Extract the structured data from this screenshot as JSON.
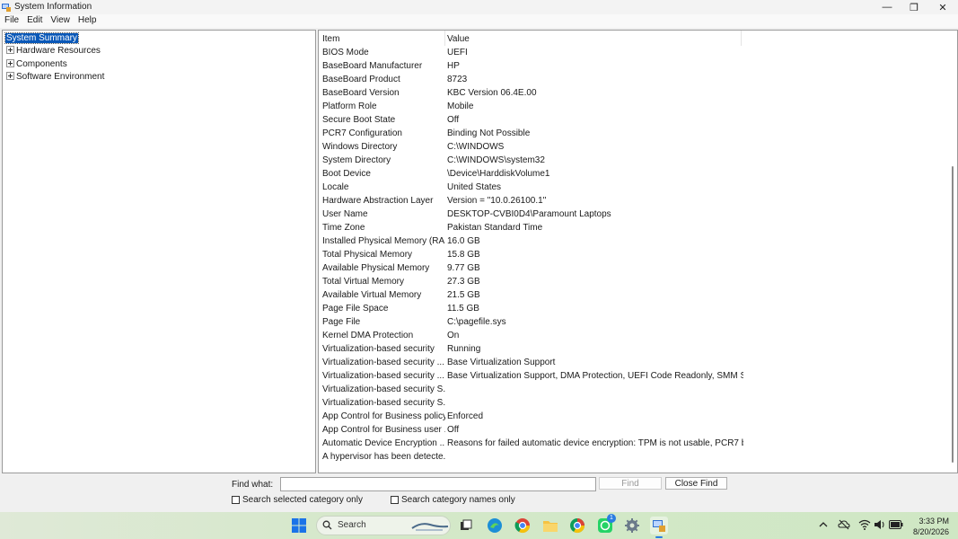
{
  "window": {
    "title": "System Information",
    "minimize": "—",
    "maximize": "❐",
    "close": "✕"
  },
  "menu": [
    "File",
    "Edit",
    "View",
    "Help"
  ],
  "tree": [
    {
      "label": "System Summary",
      "selected": true,
      "expander": false
    },
    {
      "label": "Hardware Resources",
      "selected": false,
      "expander": true
    },
    {
      "label": "Components",
      "selected": false,
      "expander": true
    },
    {
      "label": "Software Environment",
      "selected": false,
      "expander": true
    }
  ],
  "table": {
    "headers": {
      "item": "Item",
      "value": "Value"
    },
    "rows": [
      {
        "item": "BIOS Mode",
        "value": "UEFI"
      },
      {
        "item": "BaseBoard Manufacturer",
        "value": "HP"
      },
      {
        "item": "BaseBoard Product",
        "value": "8723"
      },
      {
        "item": "BaseBoard Version",
        "value": "KBC Version 06.4E.00"
      },
      {
        "item": "Platform Role",
        "value": "Mobile"
      },
      {
        "item": "Secure Boot State",
        "value": "Off"
      },
      {
        "item": "PCR7 Configuration",
        "value": "Binding Not Possible"
      },
      {
        "item": "Windows Directory",
        "value": "C:\\WINDOWS"
      },
      {
        "item": "System Directory",
        "value": "C:\\WINDOWS\\system32"
      },
      {
        "item": "Boot Device",
        "value": "\\Device\\HarddiskVolume1"
      },
      {
        "item": "Locale",
        "value": "United States"
      },
      {
        "item": "Hardware Abstraction Layer",
        "value": "Version = \"10.0.26100.1\""
      },
      {
        "item": "User Name",
        "value": "DESKTOP-CVBI0D4\\Paramount Laptops"
      },
      {
        "item": "Time Zone",
        "value": "Pakistan Standard Time"
      },
      {
        "item": "Installed Physical Memory (RA...",
        "value": "16.0 GB"
      },
      {
        "item": "Total Physical Memory",
        "value": "15.8 GB"
      },
      {
        "item": "Available Physical Memory",
        "value": "9.77 GB"
      },
      {
        "item": "Total Virtual Memory",
        "value": "27.3 GB"
      },
      {
        "item": "Available Virtual Memory",
        "value": "21.5 GB"
      },
      {
        "item": "Page File Space",
        "value": "11.5 GB"
      },
      {
        "item": "Page File",
        "value": "C:\\pagefile.sys"
      },
      {
        "item": "Kernel DMA Protection",
        "value": "On"
      },
      {
        "item": "Virtualization-based security",
        "value": "Running"
      },
      {
        "item": "Virtualization-based security ...",
        "value": "Base Virtualization Support"
      },
      {
        "item": "Virtualization-based security ...",
        "value": "Base Virtualization Support, DMA Protection, UEFI Code Readonly, SMM S..."
      },
      {
        "item": "Virtualization-based security S...",
        "value": ""
      },
      {
        "item": "Virtualization-based security S...",
        "value": ""
      },
      {
        "item": "App Control for Business policy",
        "value": "Enforced"
      },
      {
        "item": "App Control for Business user ...",
        "value": "Off"
      },
      {
        "item": "Automatic Device Encryption ...",
        "value": "Reasons for failed automatic device encryption: TPM is not usable, PCR7 bi..."
      },
      {
        "item": "A hypervisor has been detecte...",
        "value": ""
      }
    ]
  },
  "find": {
    "label": "Find what:",
    "value": "",
    "find_button": "Find",
    "close_button": "Close Find",
    "check_selected": "Search selected category only",
    "check_names": "Search category names only"
  },
  "taskbar": {
    "search_label": "Search",
    "whatsapp_badge": "1",
    "time": "3:33 PM",
    "date": "8/20/2026"
  },
  "colors": {
    "selection": "#0a58b8",
    "taskbar": "#d4e8c9"
  }
}
